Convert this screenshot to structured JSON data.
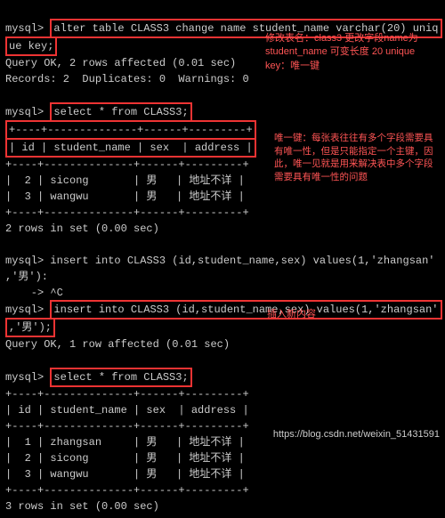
{
  "prompt": "mysql>",
  "cmd_alter": "alter table CLASS3 change name student_name varchar(20) uniq",
  "cmd_alter_cont": "ue key;",
  "res_alter1": "Query OK, 2 rows affected (0.01 sec)",
  "res_alter2": "Records: 2  Duplicates: 0  Warnings: 0",
  "cmd_select1": "select * from CLASS3;",
  "tbl_border": "+----+--------------+------+---------+",
  "tbl_header": "| id | student_name | sex  | address |",
  "tbl_row1": "|  2 | sicong       | 男   | 地址不详 |",
  "tbl_row2": "|  3 | wangwu       | 男   | 地址不详 |",
  "res_select1": "2 rows in set (0.00 sec)",
  "cmd_insert1a": "insert into CLASS3 (id,student_name,sex) values(1,'zhangsan'",
  "cmd_insert1b": ",'男'):",
  "cmd_insert_cancel": "    -> ^C",
  "cmd_insert2a": "insert into CLASS3 (id,student_name,sex) values(1,'zhangsan'",
  "cmd_insert2b": ",'男');",
  "res_insert2": "Query OK, 1 row affected (0.01 sec)",
  "cmd_select2": "select * from CLASS3;",
  "tbl2_row1": "|  1 | zhangsan     | 男   | 地址不详 |",
  "tbl2_row2": "|  2 | sicong       | 男   | 地址不详 |",
  "tbl2_row3": "|  3 | wangwu       | 男   | 地址不详 |",
  "res_select2": "3 rows in set (0.00 sec)",
  "note1": "修改表名：class3 更改字段name为student_name 可变长度 20 unique key：唯一键",
  "note2": "唯一键：每张表往往有多个字段需要具有唯一性，但是只能指定一个主键，因此，唯一见就是用来解决表中多个字段需要具有唯一性的问题",
  "note3": "插入新内容",
  "watermark": "https://blog.csdn.net/weixin_51431591"
}
